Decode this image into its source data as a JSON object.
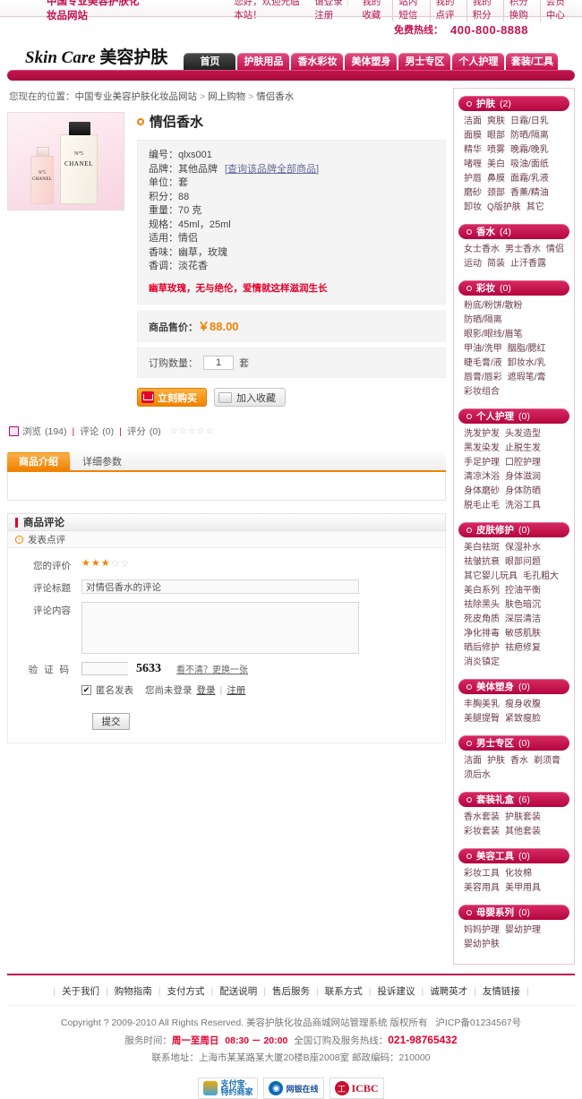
{
  "topbar": {
    "site_name": "中国专业美容护肤化妆品网站",
    "welcome": "您好，欢迎光临本站！",
    "login": "请登录",
    "register": "注册",
    "user_nav": [
      "我的收藏",
      "站内短信",
      "我的点评",
      "我的积分",
      "积分换购",
      "会员中心"
    ]
  },
  "hotline": {
    "label": "免费热线：",
    "number": "400-800-8888"
  },
  "header": {
    "logo_en": "Skin Care",
    "logo_cn": "美容护肤",
    "tabs": [
      "首页",
      "护肤用品",
      "香水彩妆",
      "美体塑身",
      "男士专区",
      "个人护理",
      "套装/工具"
    ],
    "active_tab_index": 0
  },
  "breadcrumb": {
    "prefix": "您现在的位置：",
    "items": [
      "中国专业美容护肤化妆品网站",
      "网上购物",
      "情侣香水"
    ]
  },
  "product": {
    "title": "情侣香水",
    "image_alt": "chanel-perfume-pair",
    "specs": [
      {
        "label": "编号：",
        "value": "qlxs001",
        "link": ""
      },
      {
        "label": "品牌：",
        "value": "其他品牌",
        "link": "[查询该品牌全部商品]"
      },
      {
        "label": "单位：",
        "value": "套",
        "link": ""
      },
      {
        "label": "积分：",
        "value": "88",
        "link": ""
      },
      {
        "label": "重量：",
        "value": "70 克",
        "link": ""
      },
      {
        "label": "规格：",
        "value": "45ml，25ml",
        "link": ""
      },
      {
        "label": "适用：",
        "value": "情侣",
        "link": ""
      },
      {
        "label": "香味：",
        "value": "幽草，玫瑰",
        "link": ""
      },
      {
        "label": "香调：",
        "value": "淡花香",
        "link": ""
      }
    ],
    "tagline": "幽草玫瑰，无与绝伦，爱情就这样滋润生长",
    "price_label": "商品售价：",
    "price_value": "￥88.00",
    "qty_label": "订购数量：",
    "qty_value": "1",
    "qty_unit": "套",
    "buy_button": "立刻购买",
    "fav_button": "加入收藏",
    "stats": {
      "views_label": "浏览",
      "views": "(194)",
      "comments_label": "评论",
      "comments": "(0)",
      "rating_label": "评分",
      "rating": "(0)",
      "stars_filled": 0,
      "stars_total": 5
    }
  },
  "info_tabs": {
    "items": [
      "商品介绍",
      "详细参数"
    ],
    "active_index": 0
  },
  "review": {
    "section_title": "商品评论",
    "subhead": "发表点评",
    "rating_label": "您的评价",
    "rating_stars_filled": 3,
    "rating_stars_total": 5,
    "title_label": "评论标题",
    "title_value": "对情侣香水的评论",
    "content_label": "评论内容",
    "content_value": "",
    "captcha_label": "验 证 码",
    "captcha_value": "",
    "captcha_code": "5633",
    "captcha_hint": "看不清？更换一张",
    "anon_label": "匿名发表",
    "anon_checked": true,
    "not_logged_text": "您尚未登录",
    "login_link": "登录",
    "register_link": "注册",
    "submit_label": "提交"
  },
  "sidebar": {
    "categories": [
      {
        "name": "护肤",
        "count": "(2)",
        "items": [
          "洁面",
          "爽肤",
          "日霜/日乳",
          "面膜",
          "眼部",
          "防晒/隔离",
          "精华",
          "喷雾",
          "晚霜/晚乳",
          "啫喱",
          "美白",
          "吸油/面纸",
          "护唇",
          "鼻膜",
          "面霜/乳液",
          "磨砂",
          "颈部",
          "香薰/精油",
          "卸妆",
          "Q版护肤",
          "其它"
        ]
      },
      {
        "name": "香水",
        "count": "(4)",
        "items": [
          "女士香水",
          "男士香水",
          "情侣",
          "运动",
          "简装",
          "止汗香露"
        ]
      },
      {
        "name": "彩妆",
        "count": "(0)",
        "items": [
          "粉底/粉饼/散粉",
          "防晒/隔离",
          "眼影/眼线/眉笔",
          "甲油/洗甲",
          "胭脂/腮红",
          "睫毛膏/液",
          "卸妆水/乳",
          "唇膏/唇彩",
          "遮瑕笔/膏",
          "彩妆组合"
        ]
      },
      {
        "name": "个人护理",
        "count": "(0)",
        "items": [
          "洗发护发",
          "头发造型",
          "黑发染发",
          "止脱生发",
          "手足护理",
          "口腔护理",
          "清凉沐浴",
          "身体滋润",
          "身体磨砂",
          "身体防晒",
          "脱毛止毛",
          "洗浴工具"
        ]
      },
      {
        "name": "皮肤修护",
        "count": "(0)",
        "items": [
          "美白祛斑",
          "保湿补水",
          "祛皱抗衰",
          "眼部问题",
          "其它婴儿玩具",
          "毛孔粗大",
          "美白系列",
          "控油平衡",
          "祛除黑头",
          "肤色暗沉",
          "死皮角质",
          "深层清洁",
          "净化排毒",
          "敏感肌肤",
          "晒后修护",
          "祛疤修复",
          "消炎镇定"
        ]
      },
      {
        "name": "美体塑身",
        "count": "(0)",
        "items": [
          "丰胸美乳",
          "瘦身收腹",
          "美腿提臀",
          "紧致瘦脸"
        ]
      },
      {
        "name": "男士专区",
        "count": "(0)",
        "items": [
          "洁面",
          "护肤",
          "香水",
          "剃须膏",
          "须后水"
        ]
      },
      {
        "name": "套装礼盒",
        "count": "(6)",
        "items": [
          "香水套装",
          "护肤套装",
          "彩妆套装",
          "其他套装"
        ]
      },
      {
        "name": "美容工具",
        "count": "(0)",
        "items": [
          "彩妆工具",
          "化妆棉",
          "美容用具",
          "美甲用具"
        ]
      },
      {
        "name": "母婴系列",
        "count": "(0)",
        "items": [
          "妈妈护理",
          "婴幼护理",
          "婴幼护肤"
        ]
      }
    ]
  },
  "footer": {
    "links": [
      "关于我们",
      "购物指南",
      "支付方式",
      "配送说明",
      "售后服务",
      "联系方式",
      "投诉建议",
      "诚聘英才",
      "友情链接"
    ],
    "copyright": "Copyright ? 2009-2010 All Rights Reserved. 美容护肤化妆品商城网站管理系统 版权所有",
    "icp": "沪ICP备01234567号",
    "service_label": "服务时间：",
    "service_days": "周一至周日",
    "service_hours": "08:30 － 20:00",
    "service_mid": "全国订购及服务热线：",
    "service_tel": "021-98765432",
    "address": "联系地址：上海市某某路某大厦20楼B座2008室  邮政编码：210000",
    "payments": [
      "支付宝-特约商家",
      "网银在线",
      "ICBC"
    ]
  },
  "colors": {
    "brand": "#c4134f",
    "accent_orange": "#f08200",
    "red": "#e4002b",
    "cat_header": "#b4053f"
  }
}
